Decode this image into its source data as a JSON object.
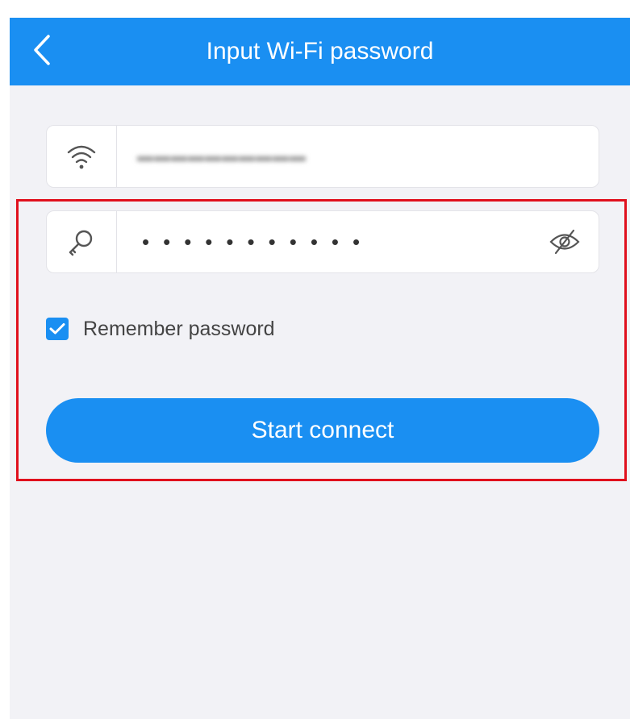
{
  "header": {
    "title": "Input Wi-Fi password",
    "back_icon": "chevron-left-icon"
  },
  "ssid_field": {
    "icon": "wifi-icon",
    "value": "▬▬▬▬▬▬▬▬▬▬",
    "value_obscured": true
  },
  "password_field": {
    "icon": "key-icon",
    "value": "•••••••••••",
    "toggle_icon": "eye-off-icon"
  },
  "remember": {
    "label": "Remember password",
    "checked": true
  },
  "connect_button": {
    "label": "Start connect"
  },
  "colors": {
    "accent": "#1a8ff2",
    "background": "#f2f2f6",
    "highlight": "#e0101d"
  }
}
